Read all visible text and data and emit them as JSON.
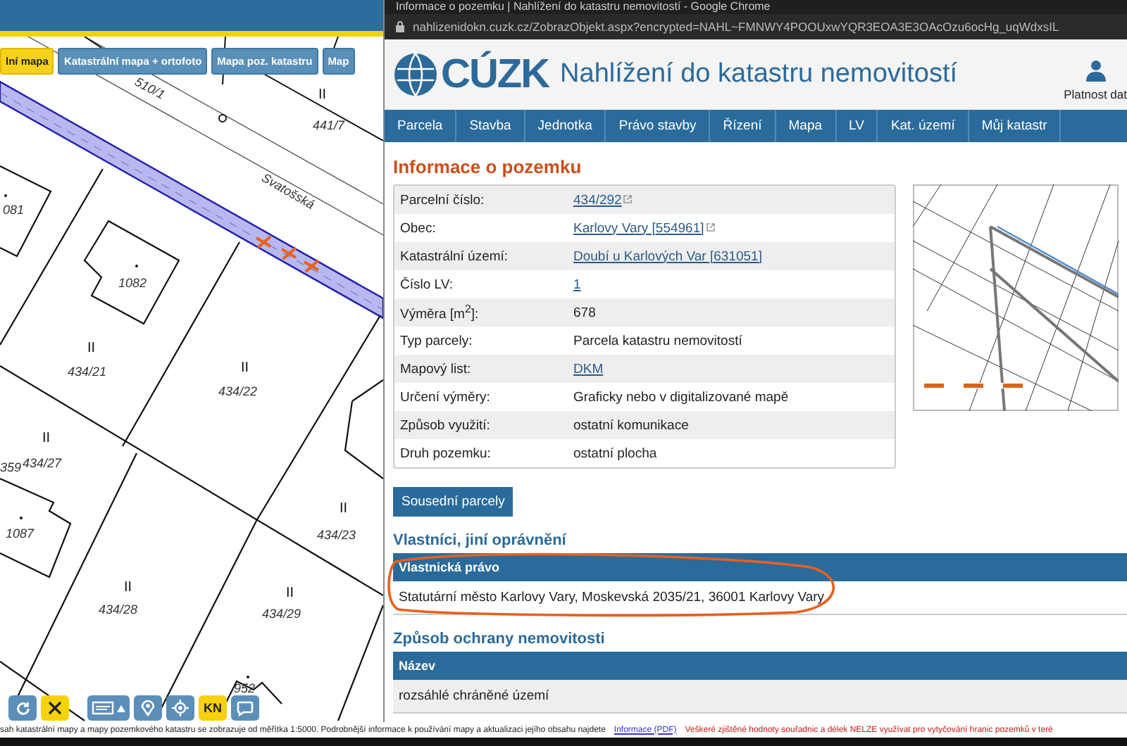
{
  "map": {
    "tabs": [
      {
        "label": "lní mapa",
        "selected": true
      },
      {
        "label": "Katastrální mapa + ortofoto",
        "selected": false
      },
      {
        "label": "Mapa poz. katastru",
        "selected": false
      },
      {
        "label": "Map",
        "selected": false
      }
    ],
    "labels": [
      "510/1",
      "II",
      "441/7",
      "Svatošská",
      "081",
      "1082",
      "II",
      "434/21",
      "II",
      "434/22",
      "II",
      "434/27",
      "359",
      "1087",
      "II",
      "434/23",
      "II",
      "434/28",
      "II",
      "434/29",
      "952"
    ],
    "tools": [
      {
        "kind": "refresh",
        "active": false
      },
      {
        "kind": "close",
        "active": true
      },
      {
        "kind": "layers",
        "active": false
      },
      {
        "kind": "pin",
        "active": false
      },
      {
        "kind": "locate",
        "active": false
      },
      {
        "kind": "text",
        "label": "KN",
        "active": true
      },
      {
        "kind": "comment",
        "active": false
      }
    ],
    "footer_text": "sah katastrální mapy a mapy pozemkového katastru se zobrazuje od měřítka 1:5000. Podrobnější informace k používání mapy a aktualizaci jejího obsahu najdete",
    "footer_link": "Informace (PDF)",
    "footer_warning": "Veškeré zjištěné hodnoty souřadnic a délek NELZE využívat pro vytyčování hranic pozemků v teré"
  },
  "browser": {
    "title": "Informace o pozemku | Nahlížení do katastru nemovitostí - Google Chrome",
    "url": "nahlizenidokn.cuzk.cz/ZobrazObjekt.aspx?encrypted=NAHL~FMNWY4POOUxwYQR3EOA3E3OAcOzu6ocHg_uqWdxsIL"
  },
  "site": {
    "logo": "CÚZK",
    "title": "Nahlížení do katastru nemovitostí",
    "user_label": "Platnost dat",
    "nav": [
      "Parcela",
      "Stavba",
      "Jednotka",
      "Právo stavby",
      "Řízení",
      "Mapa",
      "LV",
      "Kat. území",
      "Můj katastr"
    ],
    "heading": "Informace o pozemku",
    "rows": [
      {
        "label": "Parcelní číslo:",
        "value": "434/292",
        "link": true,
        "external": true
      },
      {
        "label": "Obec:",
        "value": "Karlovy Vary [554961]",
        "link": true,
        "external": true
      },
      {
        "label": "Katastrální území:",
        "value": "Doubí u Karlových Var [631051]",
        "link": true,
        "external": false
      },
      {
        "label": "Číslo LV:",
        "value": "1",
        "link": true,
        "external": false
      },
      {
        "label": "Výměra [m$^{2}$]:",
        "value": "678",
        "link": false,
        "external": false
      },
      {
        "label": "Typ parcely:",
        "value": "Parcela katastru nemovitostí",
        "link": false,
        "external": false
      },
      {
        "label": "Mapový list:",
        "value": "DKM",
        "link": true,
        "external": false
      },
      {
        "label": "Určení výměry:",
        "value": "Graficky nebo v digitalizované mapě",
        "link": false,
        "external": false
      },
      {
        "label": "Způsob využití:",
        "value": "ostatní komunikace",
        "link": false,
        "external": false
      },
      {
        "label": "Druh pozemku:",
        "value": "ostatní plocha",
        "link": false,
        "external": false
      }
    ],
    "neighbors_button": "Sousední parcely",
    "owners": {
      "heading": "Vlastníci, jiní oprávnění",
      "column": "Vlastnická právo",
      "rows": [
        "Statutární město Karlovy Vary, Moskevská 2035/21, 36001 Karlovy Vary"
      ]
    },
    "protection": {
      "heading": "Způsob ochrany nemovitosti",
      "column": "Název",
      "rows": [
        "rozsáhlé chráněné území"
      ]
    }
  }
}
